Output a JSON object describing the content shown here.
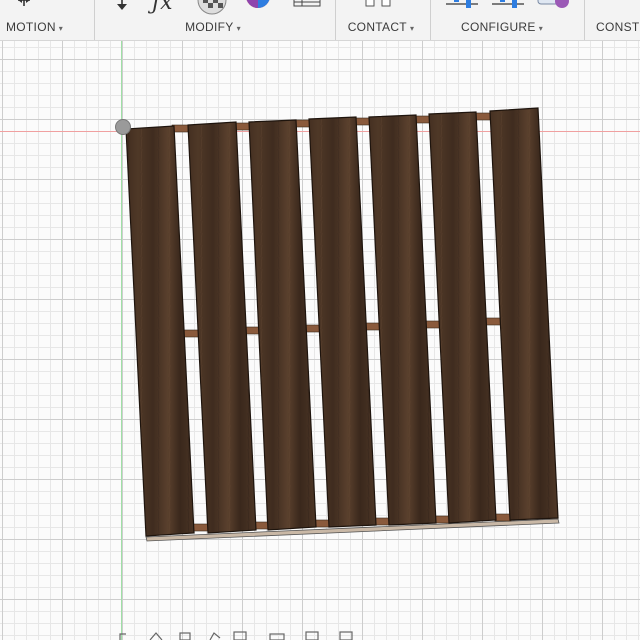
{
  "toolbar": {
    "groups": [
      {
        "label": "MOTION"
      },
      {
        "label": "MODIFY"
      },
      {
        "label": "CONTACT"
      },
      {
        "label": "CONFIGURE"
      },
      {
        "label": "CONST"
      }
    ],
    "caret": "▾",
    "fx_glyph": "ƒx"
  },
  "colors": {
    "wood_dark": "#3c2a1e",
    "wood_mid": "#4d3726",
    "wood_light": "#5e4430",
    "block_wood": "#8a5a3c",
    "axis_x": "#f0a0a0",
    "axis_y": "#9fe0a6"
  }
}
